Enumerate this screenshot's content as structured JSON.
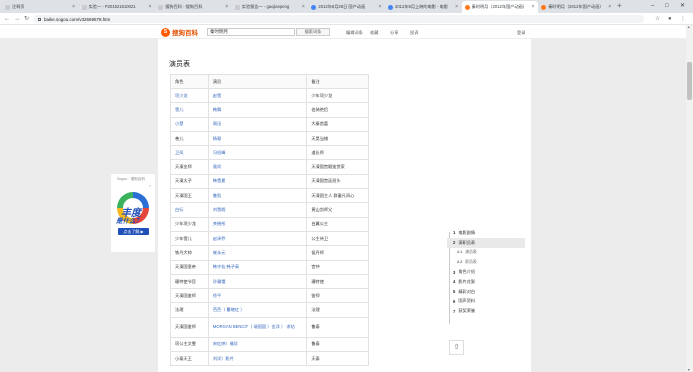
{
  "tabs": [
    {
      "title": "注释页",
      "icon": "doc-icon",
      "active": false
    },
    {
      "title": "实验一 - P201521610021",
      "icon": "doc-icon",
      "active": false
    },
    {
      "title": "搜狗百科 - 搜狗百科",
      "icon": "doc-icon",
      "active": false
    },
    {
      "title": "实验报告一 - gaojianpeng",
      "icon": "doc-icon",
      "active": false
    },
    {
      "title": "2012年8月28日 国产动画",
      "icon": "chrome-icon",
      "active": false
    },
    {
      "title": "2012年8月上映的电影 - 电影",
      "icon": "chrome-icon",
      "active": false
    },
    {
      "title": "秦时明月（2012年国产动画）",
      "icon": "sogou-icon",
      "active": true
    },
    {
      "title": "秦时明月（2012年国产动画）",
      "icon": "sogou-icon",
      "active": false
    }
  ],
  "address": {
    "url": "baike.sogou.com/v32669578.htm"
  },
  "header": {
    "logo_mark": "S",
    "logo_text": "搜狗百科",
    "search_value": "秦时明月",
    "search_button": "搜索词条",
    "links": [
      "编辑词条",
      "收藏",
      "分享",
      "投诉"
    ],
    "login": "登录"
  },
  "main": {
    "heading": "演员表",
    "columns": [
      "角色",
      "演员",
      "备注"
    ],
    "rows": [
      {
        "role": "项少龙",
        "actor": "赵雪",
        "note": "少年项少龙"
      },
      {
        "role": "雪儿",
        "actor": "韩舞",
        "note": "伯骑绝侣"
      },
      {
        "role": "小楚",
        "actor": "周迅",
        "note": "大秦首富"
      },
      {
        "role": "善儿",
        "actor": "杨幂",
        "note": "天昊当铺"
      },
      {
        "role": "卫凤",
        "actor": "冯绍峰",
        "note": "道长师"
      },
      {
        "role": "天凍金师",
        "actor": "袁尚",
        "note": "天凍国宫殿鉴赏家"
      },
      {
        "role": "天凍太子",
        "actor": "韩雪夏",
        "note": "天凍国宫廷班头"
      },
      {
        "role": "天凍国王",
        "actor": "鲁凯",
        "note": "天凍国主人 群童凡同心"
      },
      {
        "role": "白衍",
        "actor": "刘雪暇",
        "note": "黄山剑师父"
      },
      {
        "role": "少年项少龙",
        "actor": "关晓彤",
        "note": "白冀公主"
      },
      {
        "role": "少年雪儿",
        "actor": "赵泽乔",
        "note": "公主侍卫"
      },
      {
        "role": "铁丹大帅",
        "actor": "崔永元",
        "note": "侯丹师"
      },
      {
        "role": "天凍国皇帝",
        "actor": "韩守仙 韩子高",
        "note": "宫仲"
      },
      {
        "role": "珊特使节官",
        "actor": "孙骥懂",
        "note": "珊特使"
      },
      {
        "role": "天凍国鉴师",
        "actor": "徐平",
        "note": "鉴师"
      },
      {
        "role": "法理",
        "actor": "芭芭（ 瞿晓红 ）",
        "note": "法理"
      },
      {
        "role": "天凍国鉴师",
        "actor": "MORGAN BENCIT（ 瑞国国 ）金洋 ） 求钻",
        "note": "鲁泰"
      },
      {
        "role": "项公主文雯",
        "actor": "宋红婷）雅珍",
        "note": "鲁泰"
      },
      {
        "role": "小泰天王",
        "actor": "刘洋）影片",
        "note": "天泰"
      }
    ]
  },
  "ad": {
    "top_text": "Sogou · 搜狗百科",
    "close": "×",
    "big_text": "丰度",
    "question": "是什么？",
    "cta": "点击了解 ▶"
  },
  "toc": {
    "items": [
      {
        "num": "1",
        "label": "电影剧情",
        "level": 1,
        "active": false
      },
      {
        "num": "2",
        "label": "演职员表",
        "level": 1,
        "active": true
      },
      {
        "num": "2.1",
        "label": "演员表",
        "level": 2,
        "active": false
      },
      {
        "num": "2.2",
        "label": "职员表",
        "level": 2,
        "active": false
      },
      {
        "num": "3",
        "label": "角色介绍",
        "level": 1,
        "active": false
      },
      {
        "num": "4",
        "label": "影片花絮",
        "level": 1,
        "active": false
      },
      {
        "num": "5",
        "label": "精彩对白",
        "level": 1,
        "active": false
      },
      {
        "num": "6",
        "label": "国声资料",
        "level": 1,
        "active": false
      },
      {
        "num": "7",
        "label": "获奖荣誉",
        "level": 1,
        "active": false
      }
    ]
  },
  "colors": {
    "accent": "#ff5a00",
    "link": "#3366bb",
    "brand_blue": "#1f4fb8"
  }
}
